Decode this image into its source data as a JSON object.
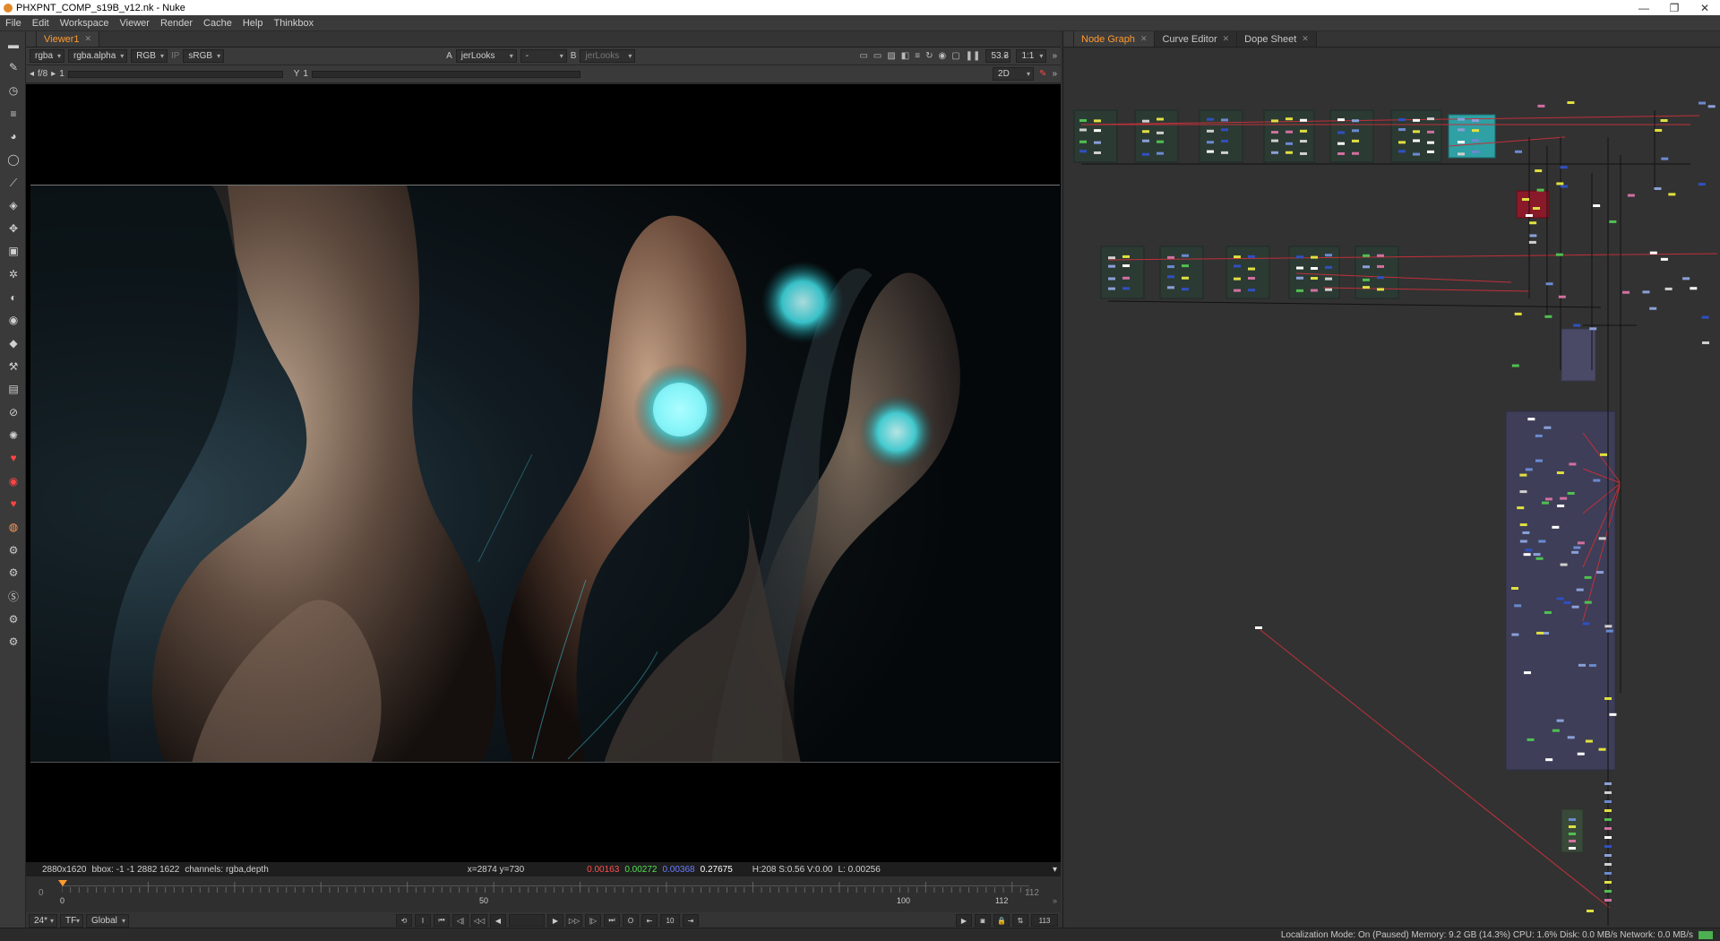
{
  "window": {
    "title": "PHXPNT_COMP_s19B_v12.nk - Nuke"
  },
  "menu": [
    "File",
    "Edit",
    "Workspace",
    "Viewer",
    "Render",
    "Cache",
    "Help",
    "Thinkbox"
  ],
  "viewer": {
    "tab_label": "Viewer1",
    "channels": "rgba",
    "alpha": "rgba.alpha",
    "display": "RGB",
    "ip_label": "IP",
    "lut": "sRGB",
    "input_a_label": "A",
    "input_a": "jerLooks",
    "input_mid": "-",
    "input_b_label": "B",
    "input_b": "jerLooks",
    "zoom": "53.3",
    "ratio": "1:1",
    "fstop": "f/8",
    "gain": "1",
    "gamma_label": "Y",
    "gamma": "1",
    "view_mode": "2D",
    "info": {
      "format": "2880x1620",
      "bbox": "bbox: -1 -1 2882 1622",
      "channels": "channels: rgba,depth",
      "coords": "x=2874 y=730",
      "r": "0.00163",
      "g": "0.00272",
      "b": "0.00368",
      "a": "0.27675",
      "hsv": "H:208 S:0.56 V:0.00",
      "lum": "L: 0.00256"
    },
    "colors": {
      "r": "#ff5050",
      "g": "#50e050",
      "b": "#6a7cff"
    }
  },
  "timeline": {
    "start": "0",
    "end": "112",
    "current": "0",
    "ticks": [
      "0",
      "50",
      "100",
      "112"
    ],
    "fps": "24*",
    "tf": "TF",
    "scope": "Global",
    "step": "10",
    "frame_out": "113"
  },
  "node_graph": {
    "tabs": [
      "Node Graph",
      "Curve Editor",
      "Dope Sheet"
    ]
  },
  "status": "Localization Mode: On (Paused) Memory: 9.2 GB (14.3%) CPU: 1.6% Disk: 0.0 MB/s Network: 0.0 MB/s"
}
